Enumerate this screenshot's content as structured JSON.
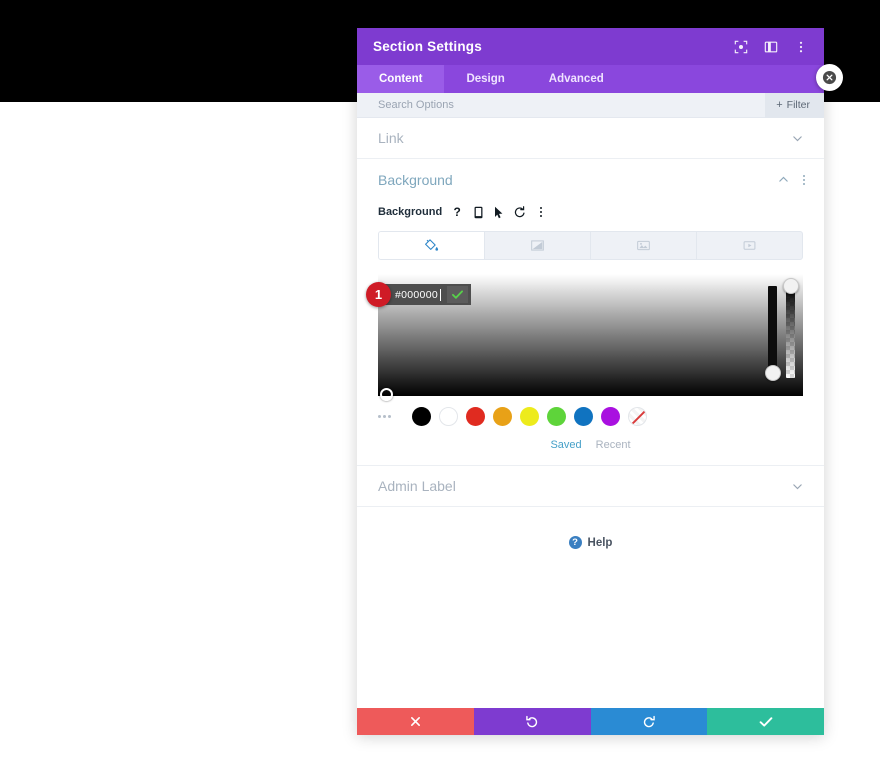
{
  "window": {
    "title": "Section Settings",
    "header_icons": [
      {
        "name": "fullscreen-icon",
        "label": "Fullscreen"
      },
      {
        "name": "layout-panel-icon",
        "label": "Change Layout"
      },
      {
        "name": "more-vertical-icon",
        "label": "More Options"
      }
    ],
    "close_icon": "close-icon"
  },
  "tabs": [
    {
      "label": "Content",
      "active": true
    },
    {
      "label": "Design",
      "active": false
    },
    {
      "label": "Advanced",
      "active": false
    }
  ],
  "search": {
    "placeholder": "Search Options",
    "value": "",
    "filter_label": "Filter",
    "filter_plus": "+"
  },
  "sections": {
    "link": {
      "title": "Link",
      "expanded": false,
      "chevron": "chevron-down-icon"
    },
    "background": {
      "title": "Background",
      "expanded": true,
      "chevron": "chevron-up-icon",
      "field_label": "Background",
      "field_icons": [
        {
          "name": "help-icon",
          "glyph": "?"
        },
        {
          "name": "responsive-device-icon"
        },
        {
          "name": "hover-cursor-icon"
        },
        {
          "name": "reset-icon"
        },
        {
          "name": "more-vertical-icon"
        }
      ],
      "type_tabs": [
        {
          "name": "background-color-tab",
          "icon": "paint-bucket-icon",
          "active": true
        },
        {
          "name": "background-gradient-tab",
          "icon": "gradient-icon",
          "active": false
        },
        {
          "name": "background-image-tab",
          "icon": "image-icon",
          "active": false
        },
        {
          "name": "background-video-tab",
          "icon": "video-icon",
          "active": false
        }
      ],
      "color_picker": {
        "step_badge": "1",
        "hex_value": "#000000",
        "confirm_icon": "check-icon",
        "hue_handle_position_pct": 88,
        "alpha_handle_position_pct": 0,
        "swatch_more_icon": "more-horizontal-icon",
        "swatches": [
          {
            "name": "swatch-black",
            "color": "#000000"
          },
          {
            "name": "swatch-white",
            "color": "#ffffff"
          },
          {
            "name": "swatch-red",
            "color": "#e02b20"
          },
          {
            "name": "swatch-orange",
            "color": "#e8a117"
          },
          {
            "name": "swatch-yellow",
            "color": "#edeb1c"
          },
          {
            "name": "swatch-green",
            "color": "#5ed43a"
          },
          {
            "name": "swatch-blue",
            "color": "#1073c0"
          },
          {
            "name": "swatch-purple",
            "color": "#a910e0"
          },
          {
            "name": "swatch-transparent",
            "color": "none"
          }
        ],
        "palette_tabs": [
          {
            "label": "Saved",
            "active": true
          },
          {
            "label": "Recent",
            "active": false
          }
        ]
      }
    },
    "admin_label": {
      "title": "Admin Label",
      "expanded": false,
      "chevron": "chevron-down-icon"
    }
  },
  "help": {
    "badge": "?",
    "label": "Help",
    "icon": "help-circle-icon"
  },
  "footer_buttons": [
    {
      "name": "cancel-button",
      "icon": "close-icon",
      "color": "#ee5a5a"
    },
    {
      "name": "undo-button",
      "icon": "undo-icon",
      "color": "#7e3bd0"
    },
    {
      "name": "redo-button",
      "icon": "redo-icon",
      "color": "#2a8bd4"
    },
    {
      "name": "save-button",
      "icon": "check-icon",
      "color": "#2dbe9c"
    }
  ]
}
